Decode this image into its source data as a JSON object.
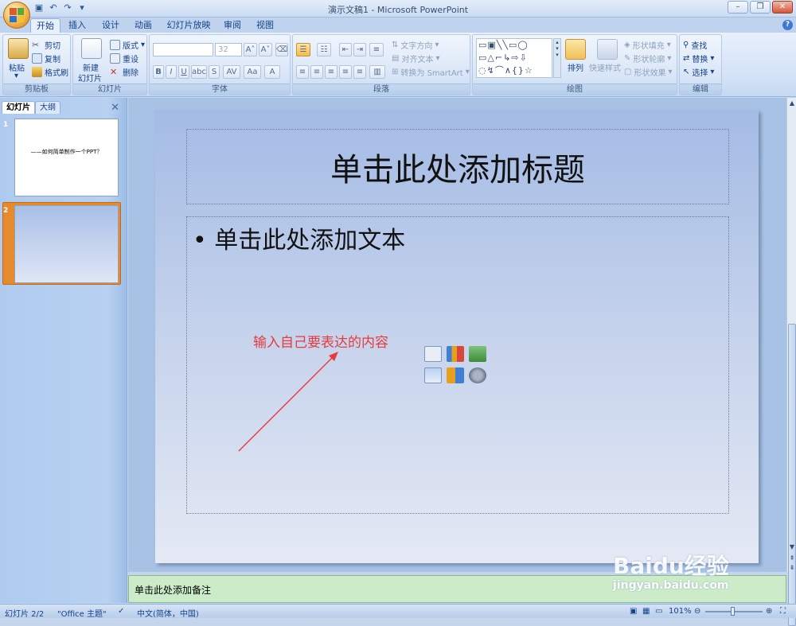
{
  "window": {
    "title": "演示文稿1 - Microsoft PowerPoint"
  },
  "ribbon_tabs": [
    "开始",
    "插入",
    "设计",
    "动画",
    "幻灯片放映",
    "审阅",
    "视图"
  ],
  "ribbon": {
    "clipboard": {
      "paste": "粘贴",
      "cut": "剪切",
      "copy": "复制",
      "format_painter": "格式刷",
      "label": "剪贴板"
    },
    "slides": {
      "new_slide_line1": "新建",
      "new_slide_line2": "幻灯片",
      "layout": "版式",
      "reset": "重设",
      "delete": "删除",
      "label": "幻灯片"
    },
    "font": {
      "font_size": "32",
      "label": "字体"
    },
    "paragraph": {
      "text_direction": "文字方向",
      "align_text": "对齐文本",
      "convert_smartart": "转换为 SmartArt",
      "label": "段落"
    },
    "drawing": {
      "arrange": "排列",
      "quick_styles": "快速样式",
      "shape_fill": "形状填充",
      "shape_outline": "形状轮廓",
      "shape_effects": "形状效果",
      "label": "绘图"
    },
    "editing": {
      "find": "查找",
      "replace": "替换",
      "select": "选择",
      "label": "编辑"
    }
  },
  "left_panel": {
    "tab_slides": "幻灯片",
    "tab_outline": "大纲",
    "slide1_num": "1",
    "slide1_text": "——如何简单制作一个PPT？",
    "slide2_num": "2"
  },
  "slide": {
    "title_placeholder": "单击此处添加标题",
    "body_placeholder": "单击此处添加文本",
    "bullet": "•"
  },
  "annotation": {
    "text": "输入自己要表达的内容",
    "color": "#e8393d"
  },
  "notes": {
    "placeholder": "单击此处添加备注"
  },
  "status_bar": {
    "slide_info": "幻灯片 2/2",
    "theme": "\"Office 主题\"",
    "language": "中文(简体，中国)",
    "zoom": "101%"
  },
  "watermark": {
    "brand": "Baidu经验",
    "url": "jingyan.baidu.com"
  },
  "colors": {
    "accent_orange": "#e68a2e",
    "notes_bg": "#ccebc8",
    "ribbon_text": "#15428b"
  }
}
